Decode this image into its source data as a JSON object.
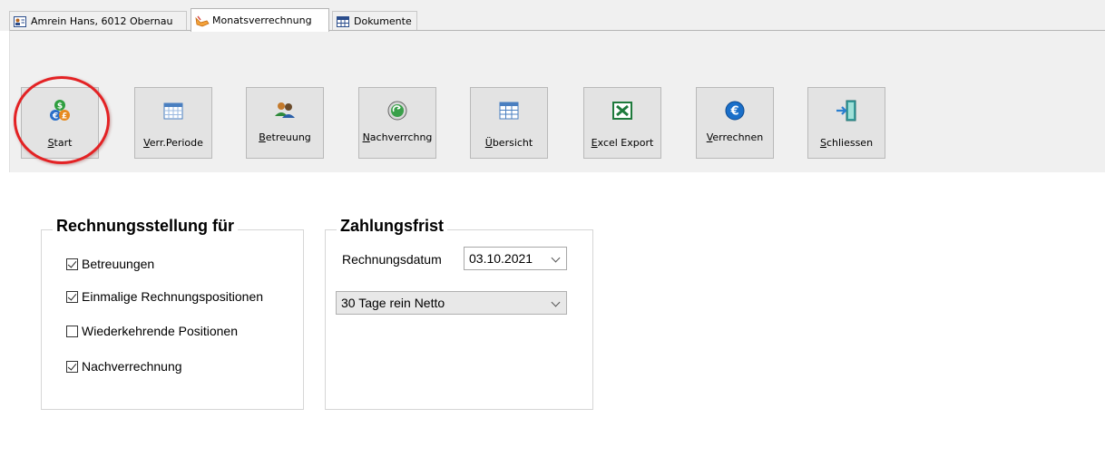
{
  "tabs": [
    {
      "label": "Amrein Hans, 6012 Obernau",
      "icon": "person-card-icon",
      "active": false
    },
    {
      "label": "Monatsverrechnung",
      "icon": "hand-icon",
      "active": true
    },
    {
      "label": "Dokumente",
      "icon": "grid-icon",
      "active": false
    }
  ],
  "toolbar": {
    "start": "Start",
    "period": "Verr.Periode",
    "care": "Betreuung",
    "rebilling": "Nachverrchng",
    "overview": "Übersicht",
    "excel": "Excel Export",
    "bill": "Verrechnen",
    "close": "Schliessen"
  },
  "billing": {
    "title": "Rechnungsstellung für",
    "items": [
      {
        "label": "Betreuungen",
        "checked": true
      },
      {
        "label": "Einmalige Rechnungspositionen",
        "checked": true
      },
      {
        "label": "Wiederkehrende Positionen",
        "checked": false
      },
      {
        "label": "Nachverrechnung",
        "checked": true
      }
    ]
  },
  "payment": {
    "title": "Zahlungsfrist",
    "date_label": "Rechnungsdatum",
    "date_value": "03.10.2021",
    "terms_value": "30 Tage rein Netto"
  },
  "colors": {
    "highlight": "#e32224",
    "excel": "#1e7a3c",
    "euro": "#1a6fc9"
  }
}
